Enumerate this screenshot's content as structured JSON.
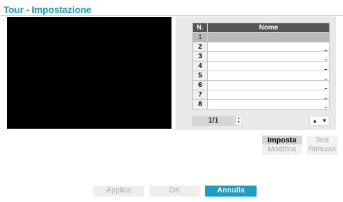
{
  "dialog": {
    "title": "Tour - Impostazione"
  },
  "table": {
    "headers": {
      "num": "N.",
      "name": "Nome"
    },
    "rows": [
      {
        "num": "1",
        "name": ""
      },
      {
        "num": "2",
        "name": ""
      },
      {
        "num": "3",
        "name": ""
      },
      {
        "num": "4",
        "name": ""
      },
      {
        "num": "5",
        "name": ""
      },
      {
        "num": "6",
        "name": ""
      },
      {
        "num": "7",
        "name": ""
      },
      {
        "num": "8",
        "name": ""
      }
    ],
    "selected_row": 1
  },
  "pager": {
    "text": "1/1"
  },
  "icons": {
    "spin_up": "▴",
    "spin_down": "▾",
    "move_up": "▲",
    "move_down": "▼"
  },
  "actions": {
    "imposta": "Imposta",
    "test": "Test",
    "modifica": "Modifica",
    "rimuovi": "Rimuovi"
  },
  "footer": {
    "applica": "Applica",
    "ok": "OK",
    "annulla": "Annulla"
  },
  "colors": {
    "accent": "#1aa0c8",
    "header_bg": "#555555",
    "selected_row_bg": "#b9b9b9",
    "disabled_text": "#aaaaaa"
  }
}
